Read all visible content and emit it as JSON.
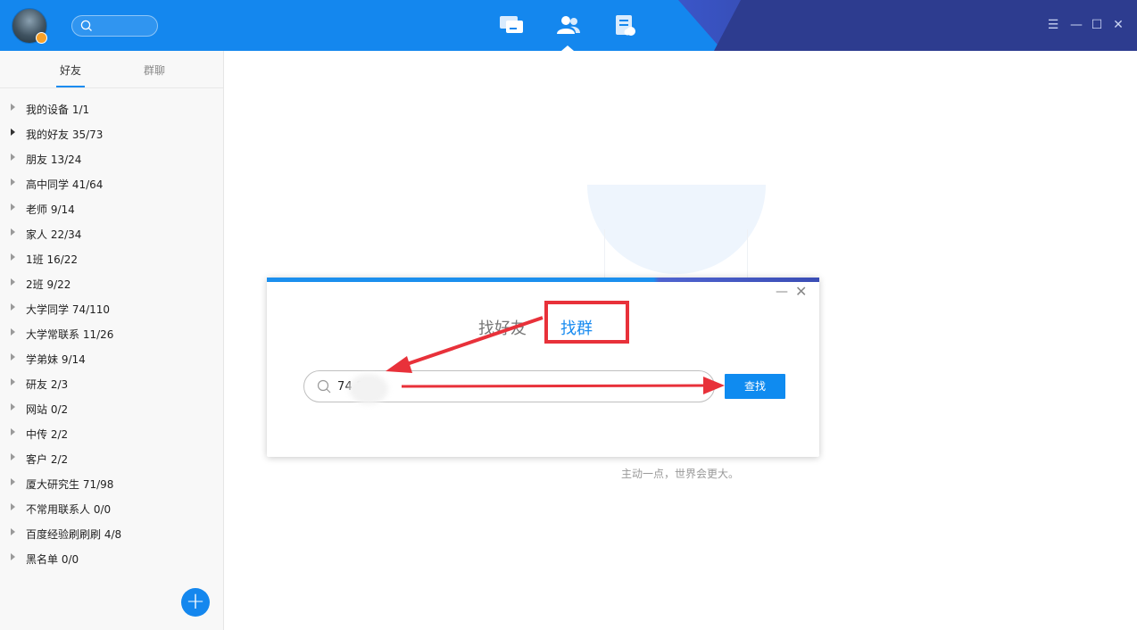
{
  "header": {
    "nav": [
      {
        "name": "messages",
        "icon": "chat-icon"
      },
      {
        "name": "contacts",
        "icon": "contacts-icon"
      },
      {
        "name": "files",
        "icon": "document-icon"
      }
    ],
    "window_controls": {
      "menu": "☰",
      "minimize": "—",
      "maximize": "☐",
      "close": "✕"
    }
  },
  "sidebar": {
    "tabs": [
      {
        "label": "好友",
        "active": true
      },
      {
        "label": "群聊",
        "active": false
      }
    ],
    "groups": [
      {
        "label": "我的设备 1/1",
        "expanded_marker": false
      },
      {
        "label": "我的好友 35/73",
        "expanded_marker": true
      },
      {
        "label": "朋友 13/24",
        "expanded_marker": false
      },
      {
        "label": "高中同学 41/64",
        "expanded_marker": false
      },
      {
        "label": "老师 9/14",
        "expanded_marker": false
      },
      {
        "label": "家人 22/34",
        "expanded_marker": false
      },
      {
        "label": "1班 16/22",
        "expanded_marker": false
      },
      {
        "label": "2班 9/22",
        "expanded_marker": false
      },
      {
        "label": "大学同学 74/110",
        "expanded_marker": false
      },
      {
        "label": "大学常联系 11/26",
        "expanded_marker": false
      },
      {
        "label": "学弟妹 9/14",
        "expanded_marker": false
      },
      {
        "label": "研友 2/3",
        "expanded_marker": false
      },
      {
        "label": "网站 0/2",
        "expanded_marker": false
      },
      {
        "label": "中传 2/2",
        "expanded_marker": false
      },
      {
        "label": "客户 2/2",
        "expanded_marker": false
      },
      {
        "label": "厦大研究生 71/98",
        "expanded_marker": false
      },
      {
        "label": "不常用联系人 0/0",
        "expanded_marker": false
      },
      {
        "label": "百度经验刷刷刷 4/8",
        "expanded_marker": false
      },
      {
        "label": "黑名单 0/0",
        "expanded_marker": false
      }
    ],
    "add_label": "+"
  },
  "main": {
    "hint": "主动一点，世界会更大。"
  },
  "dialog": {
    "tab_friends": "找好友",
    "tab_groups": "找群",
    "search_value": "74        2",
    "find_button": "查找",
    "minimize": "—",
    "close": "✕"
  },
  "colors": {
    "accent": "#1487ee",
    "annotation": "#e8313a"
  }
}
